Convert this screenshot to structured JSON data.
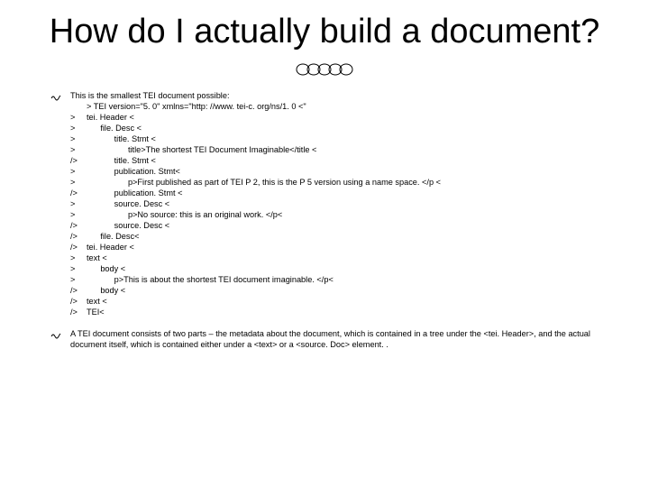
{
  "title": "How do I actually build a document?",
  "bullet1": {
    "intro": "This is the smallest TEI document possible:",
    "lines": [
      {
        "marker": "",
        "indent": 0,
        "text": "> TEI version=\"5. 0\" xmlns=\"http: //www. tei-c. org/ns/1. 0 <\""
      },
      {
        "marker": ">",
        "indent": 0,
        "text": "tei. Header <"
      },
      {
        "marker": ">",
        "indent": 1,
        "text": "file. Desc <"
      },
      {
        "marker": ">",
        "indent": 2,
        "text": "title. Stmt <"
      },
      {
        "marker": ">",
        "indent": 3,
        "text": "title>The shortest TEI Document Imaginable</title <"
      },
      {
        "marker": "/>",
        "indent": 2,
        "text": "title. Stmt <"
      },
      {
        "marker": ">",
        "indent": 2,
        "text": "publication. Stmt<"
      },
      {
        "marker": ">",
        "indent": 3,
        "text": "p>First published as part of TEI P 2, this is the P 5 version using a name space. </p <"
      },
      {
        "marker": "/>",
        "indent": 2,
        "text": "publication. Stmt <"
      },
      {
        "marker": ">",
        "indent": 2,
        "text": "source. Desc <"
      },
      {
        "marker": ">",
        "indent": 3,
        "text": "p>No source: this is an original work. </p<"
      },
      {
        "marker": "/>",
        "indent": 2,
        "text": "source. Desc <"
      },
      {
        "marker": "/>",
        "indent": 1,
        "text": "file. Desc<"
      },
      {
        "marker": "/>",
        "indent": 0,
        "text": "tei. Header <"
      },
      {
        "marker": ">",
        "indent": 0,
        "text": "text <"
      },
      {
        "marker": ">",
        "indent": 1,
        "text": "body <"
      },
      {
        "marker": ">",
        "indent": 2,
        "text": "p>This is about the shortest TEI document imaginable. </p<"
      },
      {
        "marker": "/>",
        "indent": 1,
        "text": "body <"
      },
      {
        "marker": "/>",
        "indent": 0,
        "text": "text <"
      },
      {
        "marker": "/>",
        "indent": 0,
        "text": "TEI<"
      }
    ]
  },
  "bullet2": {
    "text": "A TEI document consists of two parts – the metadata about the document, which is contained in a tree under the <tei. Header>, and the actual document itself, which is contained either under a <text> or a <source. Doc> element. ."
  }
}
